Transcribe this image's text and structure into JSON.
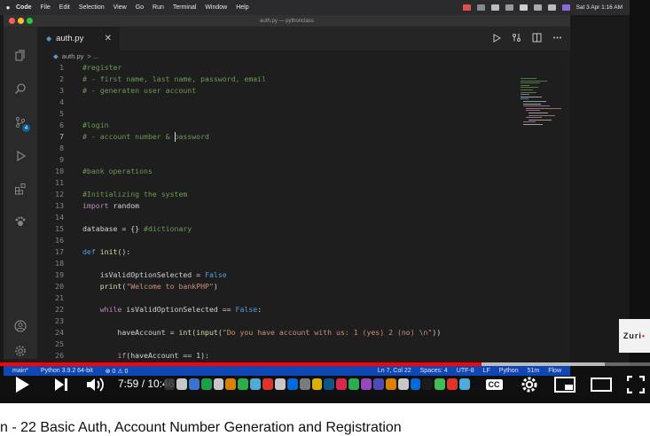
{
  "menubar": {
    "items": [
      "Code",
      "File",
      "Edit",
      "Selection",
      "View",
      "Go",
      "Run",
      "Terminal",
      "Window",
      "Help"
    ],
    "clock": "Sat 3 Apr  1:16 AM"
  },
  "window": {
    "title": "auth.py — pythonclass"
  },
  "tab": {
    "label": "auth.py",
    "close": "✕"
  },
  "breadcrumb": {
    "file": "auth.py",
    "rest": "> ..."
  },
  "editor": {
    "active_line": 7,
    "lines": [
      {
        "n": "1",
        "tokens": [
          {
            "t": "#register",
            "c": "t-comment"
          }
        ]
      },
      {
        "n": "2",
        "tokens": [
          {
            "t": "# - first name, last name, password, email",
            "c": "t-comment"
          }
        ]
      },
      {
        "n": "3",
        "tokens": [
          {
            "t": "# - generaten user account",
            "c": "t-comment"
          }
        ]
      },
      {
        "n": "4",
        "tokens": []
      },
      {
        "n": "5",
        "tokens": []
      },
      {
        "n": "6",
        "tokens": [
          {
            "t": "#login",
            "c": "t-comment"
          }
        ]
      },
      {
        "n": "7",
        "tokens": [
          {
            "t": "# - account number & password",
            "c": "t-comment"
          }
        ]
      },
      {
        "n": "8",
        "tokens": []
      },
      {
        "n": "9",
        "tokens": []
      },
      {
        "n": "10",
        "tokens": [
          {
            "t": "#bank operations",
            "c": "t-comment"
          }
        ]
      },
      {
        "n": "11",
        "tokens": []
      },
      {
        "n": "12",
        "tokens": [
          {
            "t": "#Initializing the system",
            "c": "t-comment"
          }
        ]
      },
      {
        "n": "13",
        "tokens": [
          {
            "t": "import",
            "c": "t-kw"
          },
          {
            "t": " random",
            "c": "t-plain"
          }
        ]
      },
      {
        "n": "14",
        "tokens": []
      },
      {
        "n": "15",
        "tokens": [
          {
            "t": "database = {} ",
            "c": "t-plain"
          },
          {
            "t": "#dictionary",
            "c": "t-comment"
          }
        ]
      },
      {
        "n": "16",
        "tokens": []
      },
      {
        "n": "17",
        "tokens": [
          {
            "t": "def",
            "c": "t-kw2"
          },
          {
            "t": " ",
            "c": "t-plain"
          },
          {
            "t": "init",
            "c": "t-fn"
          },
          {
            "t": "():",
            "c": "t-plain"
          }
        ]
      },
      {
        "n": "18",
        "tokens": []
      },
      {
        "n": "19",
        "tokens": [
          {
            "t": "    isValidOptionSelected = ",
            "c": "t-plain"
          },
          {
            "t": "False",
            "c": "t-kw2"
          }
        ]
      },
      {
        "n": "20",
        "tokens": [
          {
            "t": "    ",
            "c": "t-plain"
          },
          {
            "t": "print",
            "c": "t-fn"
          },
          {
            "t": "(",
            "c": "t-plain"
          },
          {
            "t": "\"Welcome to bankPHP\"",
            "c": "t-str"
          },
          {
            "t": ")",
            "c": "t-plain"
          }
        ]
      },
      {
        "n": "21",
        "tokens": []
      },
      {
        "n": "22",
        "tokens": [
          {
            "t": "    ",
            "c": "t-plain"
          },
          {
            "t": "while",
            "c": "t-kw"
          },
          {
            "t": " isValidOptionSelected == ",
            "c": "t-plain"
          },
          {
            "t": "False",
            "c": "t-kw2"
          },
          {
            "t": ":",
            "c": "t-plain"
          }
        ]
      },
      {
        "n": "23",
        "tokens": []
      },
      {
        "n": "24",
        "tokens": [
          {
            "t": "        haveAccount = ",
            "c": "t-plain"
          },
          {
            "t": "int",
            "c": "t-fn"
          },
          {
            "t": "(",
            "c": "t-plain"
          },
          {
            "t": "input",
            "c": "t-fn"
          },
          {
            "t": "(",
            "c": "t-plain"
          },
          {
            "t": "\"Do you have account with us: 1 (yes) 2 (no) \\n\"",
            "c": "t-str"
          },
          {
            "t": "))",
            "c": "t-plain"
          }
        ]
      },
      {
        "n": "25",
        "tokens": []
      },
      {
        "n": "26",
        "tokens": [
          {
            "t": "        ",
            "c": "t-plain"
          },
          {
            "t": "if",
            "c": "t-kw"
          },
          {
            "t": "(haveAccount == ",
            "c": "t-plain"
          },
          {
            "t": "1",
            "c": "t-plain"
          },
          {
            "t": "):",
            "c": "t-plain"
          }
        ]
      }
    ]
  },
  "statusbar": {
    "branch": "main*",
    "python": "Python 3.9.2 64-bit",
    "problems": "⊗ 0 ⚠ 0",
    "position": "Ln 7, Col 22",
    "spaces": "Spaces: 4",
    "encoding": "UTF-8",
    "eol": "LF",
    "language": "Python",
    "live": "51m",
    "flow": "Flow"
  },
  "overlay": {
    "channel_badge": "Zuri"
  },
  "player": {
    "time": "7:59 / 10:46",
    "progress": 0.741,
    "buffered": 0.93,
    "cc_label": "CC"
  },
  "video_title": "n - 22 Basic Auth, Account Number Generation and Registration",
  "colors": {
    "accent_red": "#ff0000",
    "statusbar_blue": "#0f47b5",
    "badge_blue": "#0e639c"
  }
}
